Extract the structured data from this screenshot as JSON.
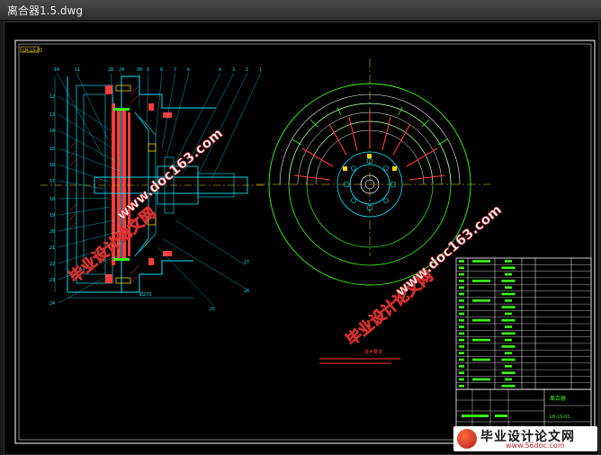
{
  "window": {
    "title": "离合器1.5.dwg"
  },
  "drawing": {
    "corner_tag": "LH-LS-01",
    "section_numbers_top": [
      "10",
      "11",
      "28",
      "29",
      "30",
      "9",
      "8",
      "7",
      "6",
      "5",
      "4",
      "3",
      "2",
      "1"
    ],
    "section_numbers_left": [
      "12",
      "13",
      "14",
      "15",
      "16",
      "17",
      "18",
      "19",
      "20",
      "21",
      "22",
      "23",
      "24"
    ],
    "section_numbers_right": [
      "27",
      "26",
      "25"
    ],
    "tech_requirements_title": "技术要求",
    "title_block": {
      "drawing_no": "LH-LS-01",
      "name": "离合器"
    }
  },
  "watermarks": {
    "site_cn": "毕业设计论文网",
    "site_url": "www.doc163.com"
  },
  "footer_brand": {
    "name": "毕业设计论文网",
    "url": "www.56doc.com"
  },
  "colors": {
    "line_cyan": "#00e5ff",
    "line_green": "#39ff14",
    "line_red": "#ff3b3b",
    "line_yellow": "#ffd400",
    "line_white": "#ffffff",
    "line_magenta": "#ff4fd8"
  }
}
